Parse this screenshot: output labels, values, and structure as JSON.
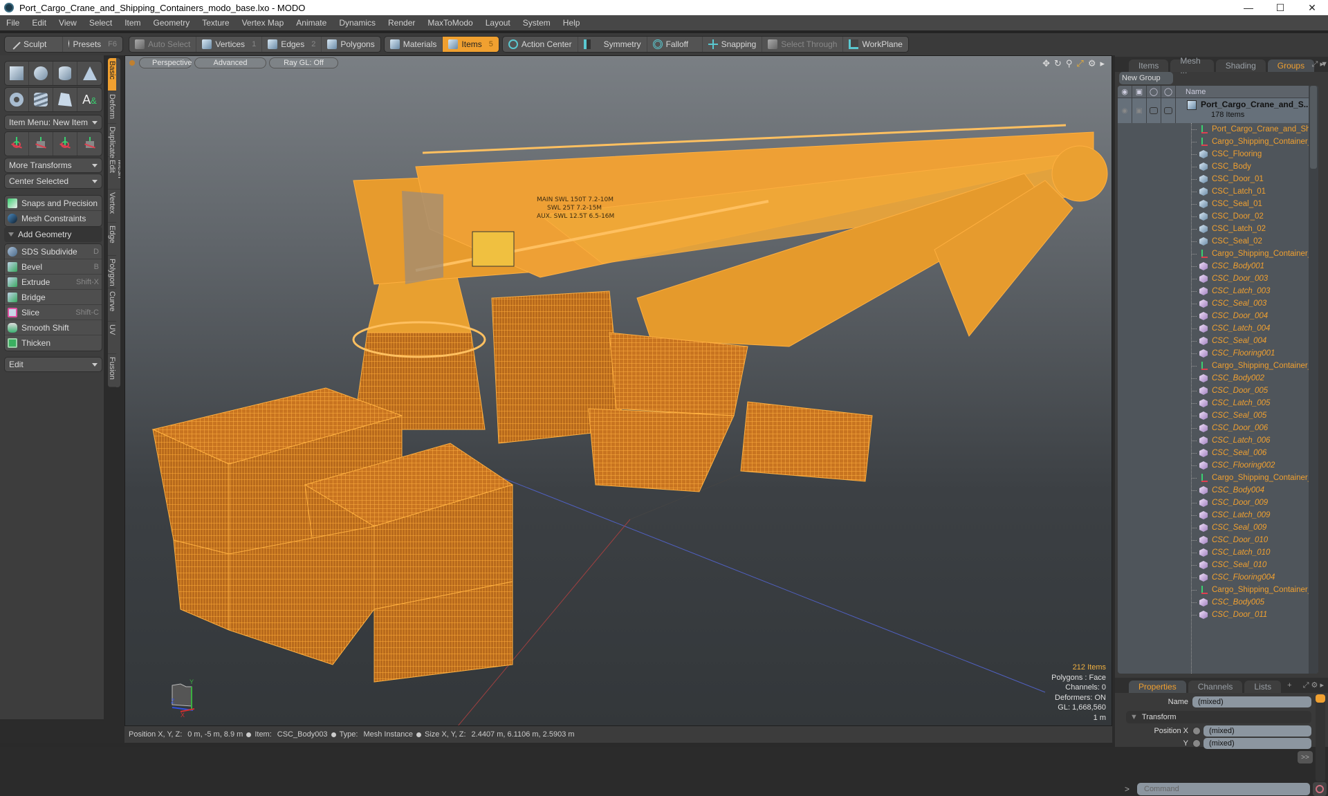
{
  "window": {
    "title": "Port_Cargo_Crane_and_Shipping_Containers_modo_base.lxo - MODO",
    "controls": [
      "minimize",
      "maximize",
      "close"
    ]
  },
  "menu": [
    "File",
    "Edit",
    "View",
    "Select",
    "Item",
    "Geometry",
    "Texture",
    "Vertex Map",
    "Animate",
    "Dynamics",
    "Render",
    "MaxToModo",
    "Layout",
    "System",
    "Help"
  ],
  "toolbar": {
    "sculpt": "Sculpt",
    "presets": "Presets",
    "presets_key": "F6",
    "auto_select": "Auto Select",
    "vertices": "Vertices",
    "vertices_key": "1",
    "edges": "Edges",
    "edges_key": "2",
    "polygons": "Polygons",
    "materials": "Materials",
    "items": "Items",
    "items_key": "5",
    "action_center": "Action Center",
    "symmetry": "Symmetry",
    "falloff": "Falloff",
    "snapping": "Snapping",
    "select_through": "Select Through",
    "workplane": "WorkPlane"
  },
  "left_panel": {
    "primitives": [
      "cube",
      "sphere",
      "cylinder",
      "cone",
      "torus",
      "spring",
      "pen-polygon",
      "text"
    ],
    "item_menu": "Item Menu: New Item",
    "transforms": [
      "move-rotate",
      "move",
      "rotate",
      "scale"
    ],
    "more_transforms": "More Transforms",
    "center_selected": "Center Selected",
    "snaps": "Snaps and Precision",
    "mesh_constraints": "Mesh Constraints",
    "add_geometry": "Add Geometry",
    "tools": [
      {
        "label": "SDS Subdivide",
        "shortcut": "D"
      },
      {
        "label": "Bevel",
        "shortcut": "B"
      },
      {
        "label": "Extrude",
        "shortcut": "Shift-X"
      },
      {
        "label": "Bridge",
        "shortcut": ""
      },
      {
        "label": "Slice",
        "shortcut": "Shift-C"
      },
      {
        "label": "Smooth Shift",
        "shortcut": ""
      },
      {
        "label": "Thicken",
        "shortcut": ""
      }
    ],
    "edit_dropdown": "Edit"
  },
  "vertical_tabs": [
    "Basic",
    "Deform",
    "Duplicate",
    "Mesh Edit",
    "Vertex",
    "Edge",
    "Polygon",
    "Curve",
    "UV",
    "Fusion"
  ],
  "viewport": {
    "view_mode": "Perspective",
    "shading": "Advanced",
    "raygl": "Ray GL: Off",
    "stats": {
      "items": "212 Items",
      "polygons": "Polygons : Face",
      "channels": "Channels: 0",
      "deformers": "Deformers: ON",
      "gl": "GL: 1,668,560",
      "scale": "1 m"
    },
    "crane_text": [
      "MAIN  SWL  150T 7.2-10M",
      "SWL   25T 7.2-15M",
      "AUX.  SWL  12.5T 6.5-16M"
    ],
    "axis_labels": {
      "x": "X",
      "y": "Y",
      "z": "Z"
    }
  },
  "statusbar": {
    "position_label": "Position X, Y, Z:",
    "position_value": "0 m, -5 m, 8.9 m",
    "item_label": "Item:",
    "item_value": "CSC_Body003",
    "type_label": "Type:",
    "type_value": "Mesh Instance",
    "size_label": "Size X, Y, Z:",
    "size_value": "2.4407 m, 6.1106 m, 2.5903 m"
  },
  "right_panel": {
    "tabs": [
      "Items",
      "Mesh ...",
      "Shading",
      "Groups"
    ],
    "active_tab": "Groups",
    "new_group": "New Group",
    "name_header": "Name",
    "root": {
      "name": "Port_Cargo_Crane_and_S...",
      "count": "178 Items"
    },
    "rows": [
      {
        "name": "Port_Cargo_Crane_and_Shi...",
        "type": "locator"
      },
      {
        "name": "Cargo_Shipping_Container_...",
        "type": "locator"
      },
      {
        "name": "CSC_Flooring",
        "type": "mesh"
      },
      {
        "name": "CSC_Body",
        "type": "mesh"
      },
      {
        "name": "CSC_Door_01",
        "type": "mesh"
      },
      {
        "name": "CSC_Latch_01",
        "type": "mesh"
      },
      {
        "name": "CSC_Seal_01",
        "type": "mesh"
      },
      {
        "name": "CSC_Door_02",
        "type": "mesh"
      },
      {
        "name": "CSC_Latch_02",
        "type": "mesh"
      },
      {
        "name": "CSC_Seal_02",
        "type": "mesh"
      },
      {
        "name": "Cargo_Shipping_Container_...",
        "type": "locator"
      },
      {
        "name": "CSC_Body001",
        "type": "instance"
      },
      {
        "name": "CSC_Door_003",
        "type": "instance"
      },
      {
        "name": "CSC_Latch_003",
        "type": "instance"
      },
      {
        "name": "CSC_Seal_003",
        "type": "instance"
      },
      {
        "name": "CSC_Door_004",
        "type": "instance"
      },
      {
        "name": "CSC_Latch_004",
        "type": "instance"
      },
      {
        "name": "CSC_Seal_004",
        "type": "instance"
      },
      {
        "name": "CSC_Flooring001",
        "type": "instance"
      },
      {
        "name": "Cargo_Shipping_Container_...",
        "type": "locator"
      },
      {
        "name": "CSC_Body002",
        "type": "instance"
      },
      {
        "name": "CSC_Door_005",
        "type": "instance"
      },
      {
        "name": "CSC_Latch_005",
        "type": "instance"
      },
      {
        "name": "CSC_Seal_005",
        "type": "instance"
      },
      {
        "name": "CSC_Door_006",
        "type": "instance"
      },
      {
        "name": "CSC_Latch_006",
        "type": "instance"
      },
      {
        "name": "CSC_Seal_006",
        "type": "instance"
      },
      {
        "name": "CSC_Flooring002",
        "type": "instance"
      },
      {
        "name": "Cargo_Shipping_Container_...",
        "type": "locator"
      },
      {
        "name": "CSC_Body004",
        "type": "instance"
      },
      {
        "name": "CSC_Door_009",
        "type": "instance"
      },
      {
        "name": "CSC_Latch_009",
        "type": "instance"
      },
      {
        "name": "CSC_Seal_009",
        "type": "instance"
      },
      {
        "name": "CSC_Door_010",
        "type": "instance"
      },
      {
        "name": "CSC_Latch_010",
        "type": "instance"
      },
      {
        "name": "CSC_Seal_010",
        "type": "instance"
      },
      {
        "name": "CSC_Flooring004",
        "type": "instance"
      },
      {
        "name": "Cargo_Shipping_Container_...",
        "type": "locator"
      },
      {
        "name": "CSC_Body005",
        "type": "instance"
      },
      {
        "name": "CSC_Door_011",
        "type": "instance"
      }
    ],
    "properties": {
      "tabs": [
        "Properties",
        "Channels",
        "Lists"
      ],
      "name_label": "Name",
      "name_value": "(mixed)",
      "transform": "Transform",
      "position_x_label": "Position X",
      "position_x_value": "(mixed)",
      "y_label": "Y",
      "y_value": "(mixed)",
      "more": ">>"
    },
    "command_placeholder": "Command"
  },
  "colors": {
    "accent": "#f0a030",
    "wireframe": "#f5a030",
    "panel": "#3a3a3a"
  }
}
